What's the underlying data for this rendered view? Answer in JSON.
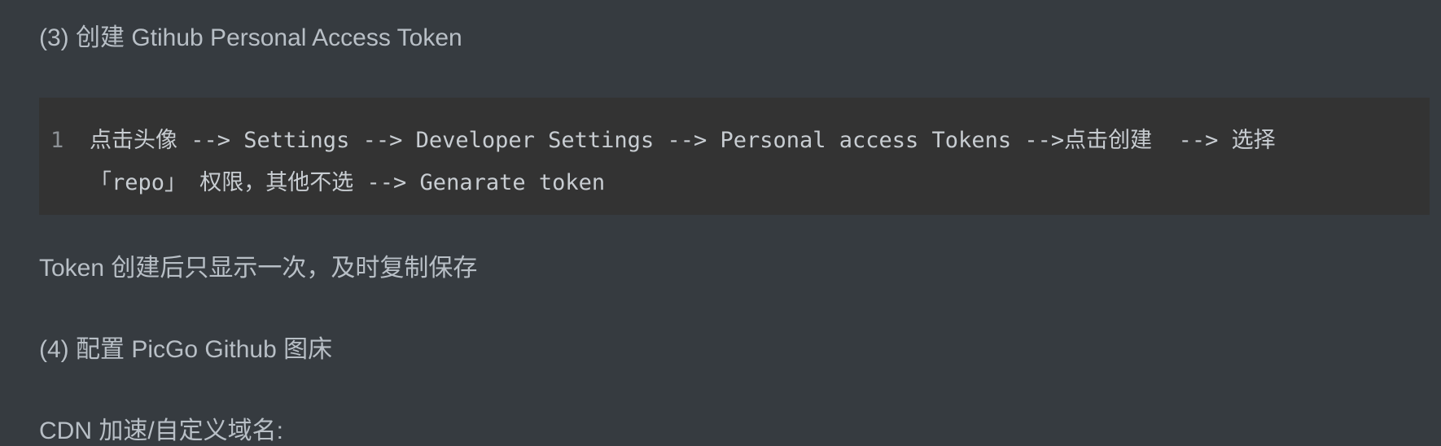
{
  "document": {
    "heading3": "(3) 创建 Gtihub Personal Access Token",
    "code_block": {
      "line_number": "1",
      "lines": [
        "点击头像 --> Settings --> Developer Settings --> Personal access Tokens -->点击创建  --> 选择",
        "「repo」 权限，其他不选 --> Genarate token"
      ]
    },
    "token_note": "Token 创建后只显示一次，及时复制保存",
    "heading4": "(4) 配置 PicGo Github 图床",
    "cdn_label": "CDN 加速/自定义域名:"
  }
}
